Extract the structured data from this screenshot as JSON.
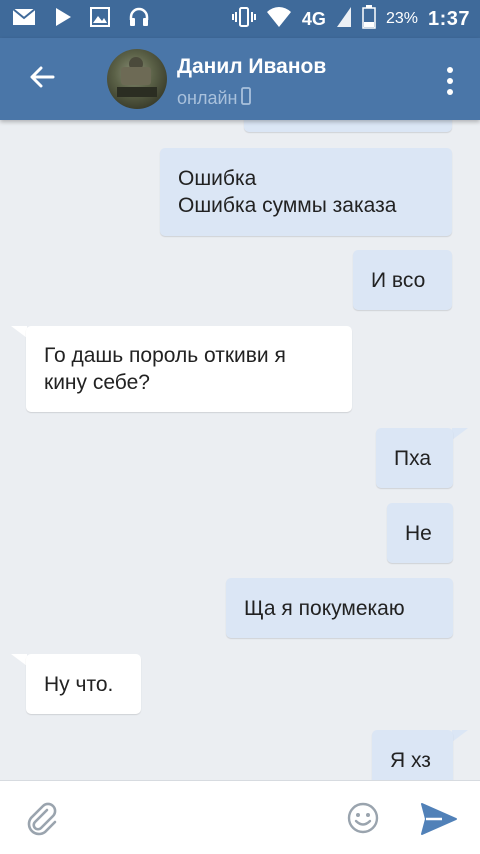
{
  "status_bar": {
    "network": "4G",
    "battery": "23%",
    "time": "1:37",
    "icons": [
      "mail-icon",
      "play-store-icon",
      "image-icon",
      "headset-icon",
      "vibrate-icon",
      "wifi-icon",
      "signal-icon",
      "battery-icon"
    ]
  },
  "header": {
    "contact_name": "Данил Иванов",
    "contact_status": "онлайн",
    "icons": [
      "back-arrow-icon",
      "mobile-icon",
      "more-vertical-icon"
    ]
  },
  "messages": [
    {
      "direction": "out",
      "lines": [
        "Ошибка",
        "Ошибка суммы заказа"
      ]
    },
    {
      "direction": "out",
      "lines": [
        "И всо"
      ]
    },
    {
      "direction": "in",
      "lines": [
        "Го дашь пороль откиви я",
        "кину себе?"
      ]
    },
    {
      "direction": "out",
      "lines": [
        "Пха"
      ]
    },
    {
      "direction": "out",
      "lines": [
        "Не"
      ]
    },
    {
      "direction": "out",
      "lines": [
        "Ща я покумекаю"
      ]
    },
    {
      "direction": "in",
      "lines": [
        "Ну что."
      ]
    },
    {
      "direction": "out",
      "lines": [
        "Я хз"
      ]
    }
  ],
  "composer": {
    "icons": [
      "paperclip-icon",
      "emoji-icon",
      "send-icon"
    ]
  },
  "colors": {
    "status_bar": "#3f6a9a",
    "header": "#4a76a8",
    "chat_background": "#ebeef2",
    "outgoing_bubble": "#dbe6f5",
    "incoming_bubble": "#ffffff",
    "send_accent": "#5181b8"
  }
}
